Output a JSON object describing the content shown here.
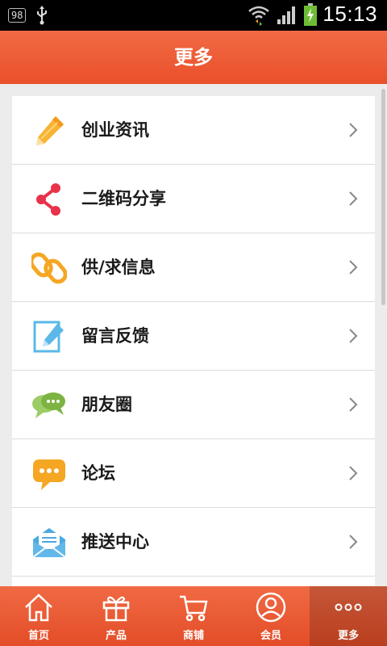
{
  "status_bar": {
    "notification_count": "98",
    "usb_icon": "usb-icon",
    "wifi_icon": "wifi-icon",
    "signal_icon": "signal-icon",
    "battery_icon": "battery-charging-icon",
    "time": "15:13"
  },
  "header": {
    "title": "更多"
  },
  "menu": {
    "items": [
      {
        "label": "创业资讯",
        "icon": "pencil-icon"
      },
      {
        "label": "二维码分享",
        "icon": "share-icon"
      },
      {
        "label": "供/求信息",
        "icon": "chain-link-icon"
      },
      {
        "label": "留言反馈",
        "icon": "feedback-edit-icon"
      },
      {
        "label": "朋友圈",
        "icon": "chat-bubbles-icon"
      },
      {
        "label": "论坛",
        "icon": "forum-bubble-icon"
      },
      {
        "label": "推送中心",
        "icon": "envelope-icon"
      }
    ]
  },
  "tabbar": {
    "tabs": [
      {
        "label": "首页",
        "icon": "home-icon"
      },
      {
        "label": "产品",
        "icon": "gift-icon"
      },
      {
        "label": "商铺",
        "icon": "cart-icon"
      },
      {
        "label": "会员",
        "icon": "member-icon"
      },
      {
        "label": "更多",
        "icon": "more-dots-icon",
        "active": true
      }
    ]
  },
  "colors": {
    "brand": "#ec5a33",
    "divider": "#dcdcdc"
  }
}
